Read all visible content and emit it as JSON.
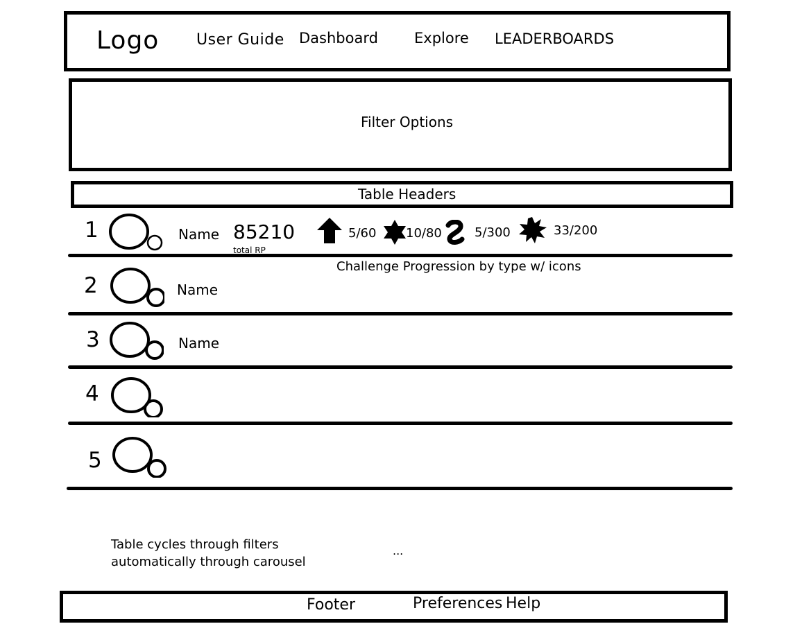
{
  "header": {
    "logo": "Logo",
    "nav": {
      "user_guide": "User Guide",
      "dashboard": "Dashboard",
      "explore": "Explore",
      "leaderboards": "LEADERBOARDS"
    }
  },
  "filter": {
    "label": "Filter Options"
  },
  "table": {
    "header_label": "Table Headers",
    "rows": [
      {
        "rank": "1",
        "name": "Name"
      },
      {
        "rank": "2",
        "name": "Name"
      },
      {
        "rank": "3",
        "name": "Name"
      },
      {
        "rank": "4",
        "name": ""
      },
      {
        "rank": "5",
        "name": ""
      }
    ],
    "first_row": {
      "score": "85210",
      "score_label": "total RP",
      "challenges": [
        {
          "icon": "arrow-up-icon",
          "progress": "5/60"
        },
        {
          "icon": "star-six-point-icon",
          "progress": "10/80"
        },
        {
          "icon": "squiggle-icon",
          "progress": "5/300"
        },
        {
          "icon": "burst-icon",
          "progress": "33/200"
        }
      ]
    },
    "caption": "Challenge Progression by type w/ icons"
  },
  "notes": {
    "carousel": "Table cycles through filters automatically through carousel",
    "ellipsis": "..."
  },
  "footer": {
    "label": "Footer",
    "preferences": "Preferences",
    "help": "Help"
  }
}
